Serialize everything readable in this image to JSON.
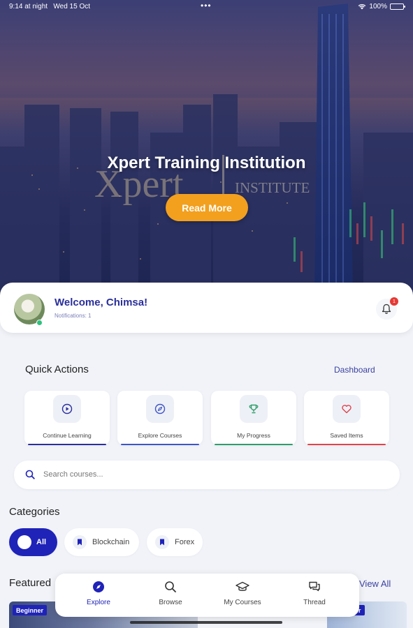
{
  "status_bar": {
    "time": "9:14 at night",
    "date": "Wed 15 Oct",
    "battery": "100%"
  },
  "hero": {
    "title": "Xpert Training Institution",
    "logo_word": "Xpert",
    "logo_sub": "INSTITUTE",
    "cta_label": "Read More"
  },
  "welcome": {
    "greeting": "Welcome, Chimsa!",
    "notifications": "Notifications: 1",
    "badge_count": "1"
  },
  "quick_actions": {
    "title": "Quick Actions",
    "dashboard_link": "Dashboard",
    "items": [
      {
        "label": "Continue Learning",
        "icon": "play-circle-icon",
        "color": "#2a2f9a"
      },
      {
        "label": "Explore Courses",
        "icon": "compass-icon",
        "color": "#3d55c7"
      },
      {
        "label": "My Progress",
        "icon": "trophy-icon",
        "color": "#2e9e6a"
      },
      {
        "label": "Saved Items",
        "icon": "heart-icon",
        "color": "#e0434b"
      }
    ]
  },
  "search": {
    "placeholder": "Search courses..."
  },
  "categories": {
    "title": "Categories",
    "items": [
      {
        "label": "All",
        "active": true
      },
      {
        "label": "Blockchain",
        "active": false
      },
      {
        "label": "Forex",
        "active": false
      }
    ]
  },
  "featured": {
    "title": "Featured",
    "view_all": "View All",
    "cards": [
      {
        "level": "Beginner"
      },
      {
        "level": "..er"
      }
    ]
  },
  "bottom_nav": {
    "items": [
      {
        "label": "Explore",
        "icon": "compass-icon",
        "active": true
      },
      {
        "label": "Browse",
        "icon": "search-icon",
        "active": false
      },
      {
        "label": "My Courses",
        "icon": "graduation-cap-icon",
        "active": false
      },
      {
        "label": "Thread",
        "icon": "chat-icon",
        "active": false
      }
    ]
  },
  "colors": {
    "primary": "#1f23b8",
    "accent": "#f2a01e",
    "background": "#f1f3f8"
  }
}
